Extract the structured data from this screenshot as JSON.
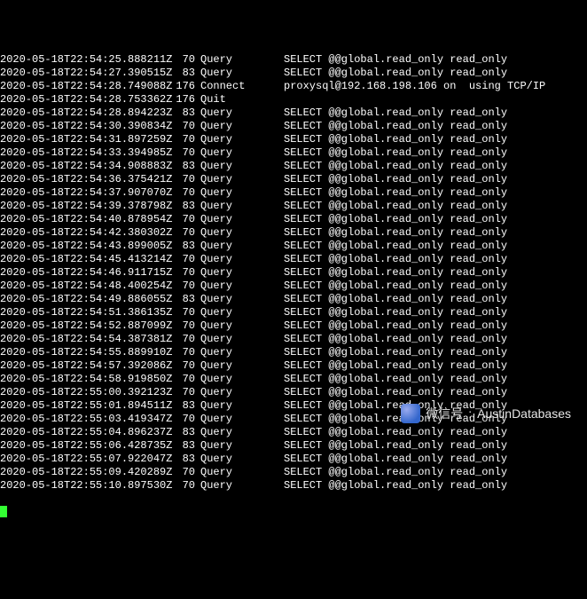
{
  "query_text": "SELECT @@global.read_only read_only",
  "connect_text": "proxysql@192.168.198.106 on  using TCP/IP",
  "quit_text": "",
  "watermark": {
    "label": "微信号",
    "value": "AustinDatabases"
  },
  "rows": [
    {
      "ts": "2020-05-18T22:54:25.888211Z",
      "id": 70,
      "cmd": "Query",
      "type": "query"
    },
    {
      "ts": "2020-05-18T22:54:27.390515Z",
      "id": 83,
      "cmd": "Query",
      "type": "query"
    },
    {
      "ts": "2020-05-18T22:54:28.749088Z",
      "id": 176,
      "cmd": "Connect",
      "type": "connect"
    },
    {
      "ts": "2020-05-18T22:54:28.753362Z",
      "id": 176,
      "cmd": "Quit",
      "type": "quit"
    },
    {
      "ts": "2020-05-18T22:54:28.894223Z",
      "id": 83,
      "cmd": "Query",
      "type": "query"
    },
    {
      "ts": "2020-05-18T22:54:30.390834Z",
      "id": 70,
      "cmd": "Query",
      "type": "query"
    },
    {
      "ts": "2020-05-18T22:54:31.897259Z",
      "id": 70,
      "cmd": "Query",
      "type": "query"
    },
    {
      "ts": "2020-05-18T22:54:33.394985Z",
      "id": 70,
      "cmd": "Query",
      "type": "query"
    },
    {
      "ts": "2020-05-18T22:54:34.908883Z",
      "id": 83,
      "cmd": "Query",
      "type": "query"
    },
    {
      "ts": "2020-05-18T22:54:36.375421Z",
      "id": 70,
      "cmd": "Query",
      "type": "query"
    },
    {
      "ts": "2020-05-18T22:54:37.907070Z",
      "id": 70,
      "cmd": "Query",
      "type": "query"
    },
    {
      "ts": "2020-05-18T22:54:39.378798Z",
      "id": 83,
      "cmd": "Query",
      "type": "query"
    },
    {
      "ts": "2020-05-18T22:54:40.878954Z",
      "id": 70,
      "cmd": "Query",
      "type": "query"
    },
    {
      "ts": "2020-05-18T22:54:42.380302Z",
      "id": 70,
      "cmd": "Query",
      "type": "query"
    },
    {
      "ts": "2020-05-18T22:54:43.899005Z",
      "id": 83,
      "cmd": "Query",
      "type": "query"
    },
    {
      "ts": "2020-05-18T22:54:45.413214Z",
      "id": 70,
      "cmd": "Query",
      "type": "query"
    },
    {
      "ts": "2020-05-18T22:54:46.911715Z",
      "id": 70,
      "cmd": "Query",
      "type": "query"
    },
    {
      "ts": "2020-05-18T22:54:48.400254Z",
      "id": 70,
      "cmd": "Query",
      "type": "query"
    },
    {
      "ts": "2020-05-18T22:54:49.886055Z",
      "id": 83,
      "cmd": "Query",
      "type": "query"
    },
    {
      "ts": "2020-05-18T22:54:51.386135Z",
      "id": 70,
      "cmd": "Query",
      "type": "query"
    },
    {
      "ts": "2020-05-18T22:54:52.887099Z",
      "id": 70,
      "cmd": "Query",
      "type": "query"
    },
    {
      "ts": "2020-05-18T22:54:54.387381Z",
      "id": 70,
      "cmd": "Query",
      "type": "query"
    },
    {
      "ts": "2020-05-18T22:54:55.889910Z",
      "id": 70,
      "cmd": "Query",
      "type": "query"
    },
    {
      "ts": "2020-05-18T22:54:57.392086Z",
      "id": 70,
      "cmd": "Query",
      "type": "query"
    },
    {
      "ts": "2020-05-18T22:54:58.919850Z",
      "id": 70,
      "cmd": "Query",
      "type": "query"
    },
    {
      "ts": "2020-05-18T22:55:00.392123Z",
      "id": 70,
      "cmd": "Query",
      "type": "query"
    },
    {
      "ts": "2020-05-18T22:55:01.894511Z",
      "id": 83,
      "cmd": "Query",
      "type": "query"
    },
    {
      "ts": "2020-05-18T22:55:03.419347Z",
      "id": 70,
      "cmd": "Query",
      "type": "query"
    },
    {
      "ts": "2020-05-18T22:55:04.896237Z",
      "id": 83,
      "cmd": "Query",
      "type": "query"
    },
    {
      "ts": "2020-05-18T22:55:06.428735Z",
      "id": 83,
      "cmd": "Query",
      "type": "query"
    },
    {
      "ts": "2020-05-18T22:55:07.922047Z",
      "id": 83,
      "cmd": "Query",
      "type": "query"
    },
    {
      "ts": "2020-05-18T22:55:09.420289Z",
      "id": 70,
      "cmd": "Query",
      "type": "query"
    },
    {
      "ts": "2020-05-18T22:55:10.897530Z",
      "id": 70,
      "cmd": "Query",
      "type": "query"
    }
  ]
}
